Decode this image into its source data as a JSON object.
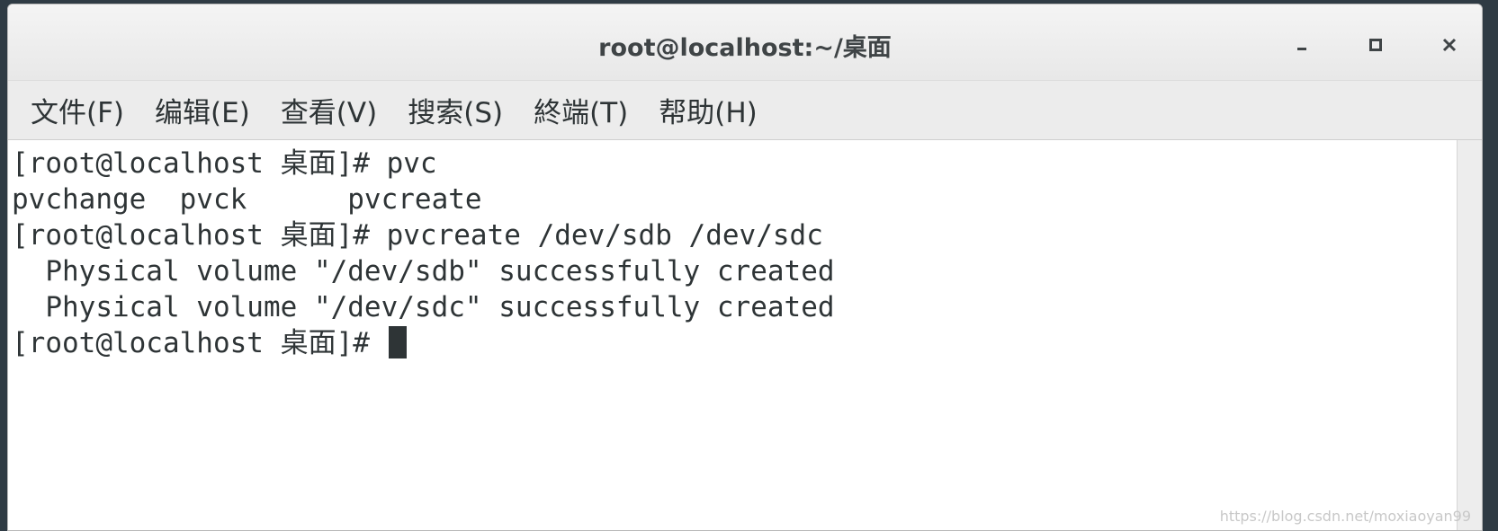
{
  "window": {
    "title": "root@localhost:~/桌面"
  },
  "menu": [
    {
      "label": "文件(F)"
    },
    {
      "label": "编辑(E)"
    },
    {
      "label": "查看(V)"
    },
    {
      "label": "搜索(S)"
    },
    {
      "label": "終端(T)"
    },
    {
      "label": "帮助(H)"
    }
  ],
  "terminal": {
    "lines": [
      "[root@localhost 桌面]# pvc",
      "pvchange  pvck      pvcreate",
      "[root@localhost 桌面]# pvcreate /dev/sdb /dev/sdc",
      "  Physical volume \"/dev/sdb\" successfully created",
      "  Physical volume \"/dev/sdc\" successfully created",
      "[root@localhost 桌面]# "
    ]
  },
  "watermark": "https://blog.csdn.net/moxiaoyan99",
  "colors": {
    "background": "#2f3b44",
    "titlebar": "#efefef",
    "menubar": "#ececec",
    "terminal_bg": "#ffffff",
    "terminal_fg": "#2e3436"
  },
  "icons": {
    "minimize": "minimize-icon",
    "maximize": "maximize-icon",
    "close": "close-icon"
  }
}
